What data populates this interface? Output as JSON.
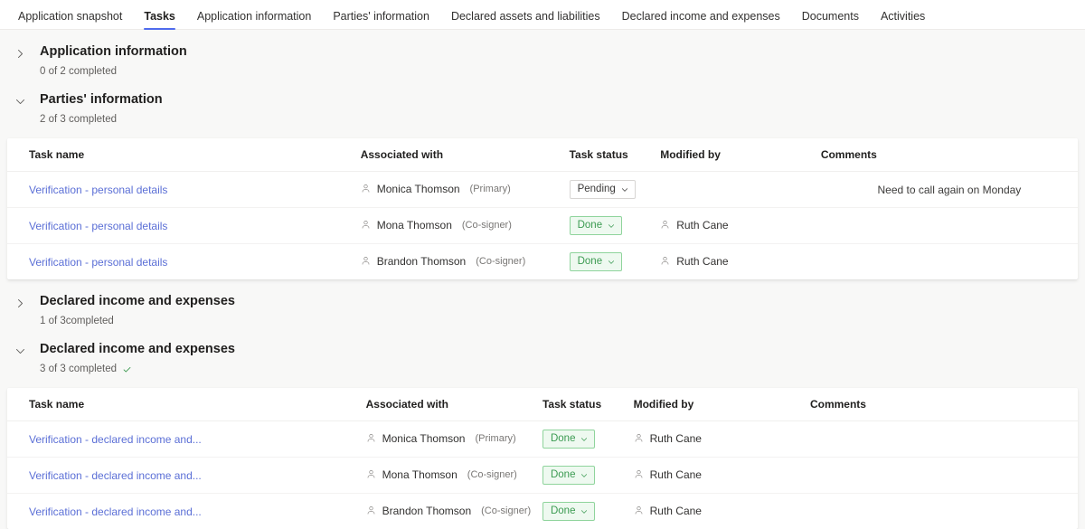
{
  "tabs": [
    {
      "label": "Application snapshot",
      "active": false
    },
    {
      "label": "Tasks",
      "active": true
    },
    {
      "label": "Application information",
      "active": false
    },
    {
      "label": "Parties' information",
      "active": false
    },
    {
      "label": "Declared assets and liabilities",
      "active": false
    },
    {
      "label": "Declared income and expenses",
      "active": false
    },
    {
      "label": "Documents",
      "active": false
    },
    {
      "label": "Activities",
      "active": false
    }
  ],
  "colors": {
    "accent": "#4f6bed",
    "link": "#5b6fd6",
    "done_text": "#3c9b52",
    "done_border": "#8fd49c",
    "done_bg": "#eef9f0",
    "pending_border": "#d7d5d3",
    "page_bg": "#f8f8f7",
    "card_bg": "#ffffff",
    "check_green": "#3d9a50"
  },
  "columns": [
    "Task name",
    "Associated with",
    "Task status",
    "Modified by",
    "Comments"
  ],
  "sections": [
    {
      "title": "Application information",
      "subtitle": "0 of 2 completed",
      "expanded": false,
      "complete": false
    },
    {
      "title": "Parties' information",
      "subtitle": "2 of 3 completed",
      "expanded": true,
      "complete": false,
      "rows": [
        {
          "task": "Verification - personal details",
          "person": "Monica Thomson",
          "role": "(Primary)",
          "status": "Pending",
          "status_kind": "pending",
          "modified_by": "",
          "comment": "Need to call again on Monday"
        },
        {
          "task": "Verification - personal details",
          "person": "Mona Thomson",
          "role": "(Co-signer)",
          "status": "Done",
          "status_kind": "done",
          "modified_by": "Ruth Cane",
          "comment": ""
        },
        {
          "task": "Verification - personal details",
          "person": "Brandon Thomson",
          "role": "(Co-signer)",
          "status": "Done",
          "status_kind": "done",
          "modified_by": "Ruth Cane",
          "comment": ""
        }
      ]
    },
    {
      "title": "Declared income and expenses",
      "subtitle": "1 of 3completed",
      "expanded": false,
      "complete": false
    },
    {
      "title": "Declared income and expenses",
      "subtitle": "3 of 3 completed",
      "expanded": true,
      "complete": true,
      "rows": [
        {
          "task": "Verification - declared income and...",
          "person": "Monica Thomson",
          "role": "(Primary)",
          "status": "Done",
          "status_kind": "done",
          "modified_by": "Ruth Cane",
          "comment": ""
        },
        {
          "task": "Verification - declared income and...",
          "person": "Mona Thomson",
          "role": "(Co-signer)",
          "status": "Done",
          "status_kind": "done",
          "modified_by": "Ruth Cane",
          "comment": ""
        },
        {
          "task": "Verification - declared income and...",
          "person": "Brandon Thomson",
          "role": "(Co-signer)",
          "status": "Done",
          "status_kind": "done",
          "modified_by": "Ruth Cane",
          "comment": ""
        }
      ]
    }
  ]
}
